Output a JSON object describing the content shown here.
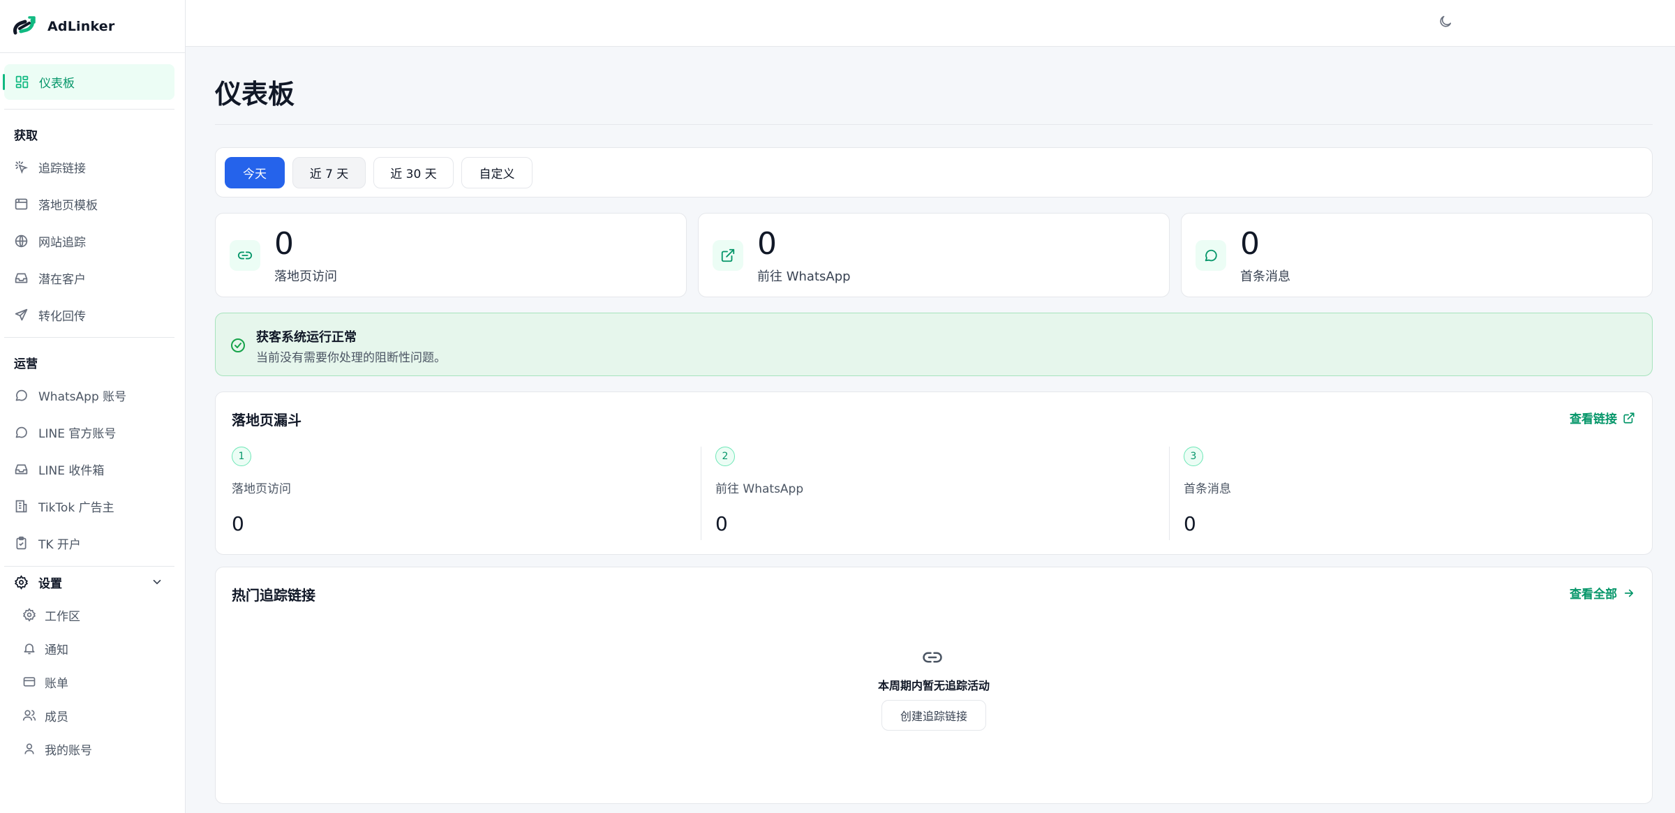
{
  "brand": {
    "name": "AdLinker"
  },
  "sidebar": {
    "active": {
      "label": "仪表板",
      "icon": "dashboard-icon"
    },
    "sections": [
      {
        "title": "获取",
        "items": [
          {
            "label": "追踪链接",
            "icon": "tracking-link-icon"
          },
          {
            "label": "落地页模板",
            "icon": "template-icon"
          },
          {
            "label": "网站追踪",
            "icon": "globe-icon"
          },
          {
            "label": "潜在客户",
            "icon": "inbox-icon"
          },
          {
            "label": "转化回传",
            "icon": "send-icon"
          }
        ]
      },
      {
        "title": "运营",
        "items": [
          {
            "label": "WhatsApp 账号",
            "icon": "chat-icon"
          },
          {
            "label": "LINE 官方账号",
            "icon": "chat-icon"
          },
          {
            "label": "LINE 收件箱",
            "icon": "inbox-icon"
          },
          {
            "label": "TikTok 广告主",
            "icon": "building-icon"
          },
          {
            "label": "TK 开户",
            "icon": "clipboard-icon"
          }
        ]
      }
    ],
    "settings": {
      "label": "设置",
      "items": [
        {
          "label": "工作区",
          "icon": "gear-icon"
        },
        {
          "label": "通知",
          "icon": "bell-icon"
        },
        {
          "label": "账单",
          "icon": "credit-card-icon"
        },
        {
          "label": "成员",
          "icon": "users-icon"
        },
        {
          "label": "我的账号",
          "icon": "user-icon"
        }
      ]
    }
  },
  "topbar": {
    "theme_icon": "moon-icon"
  },
  "page": {
    "title": "仪表板"
  },
  "ranges": {
    "options": [
      "今天",
      "近 7 天",
      "近 30 天",
      "自定义"
    ],
    "selected": "今天"
  },
  "stats": [
    {
      "value": "0",
      "label": "落地页访问",
      "icon": "link-icon"
    },
    {
      "value": "0",
      "label": "前往 WhatsApp",
      "icon": "external-link-icon"
    },
    {
      "value": "0",
      "label": "首条消息",
      "icon": "message-icon"
    }
  ],
  "health": {
    "title": "获客系统运行正常",
    "desc": "当前没有需要你处理的阻断性问题。",
    "icon": "check-circle-icon",
    "color": "#16a34a"
  },
  "funnel": {
    "title": "落地页漏斗",
    "link": "查看链接",
    "steps": [
      {
        "num": "1",
        "label": "落地页访问",
        "value": "0"
      },
      {
        "num": "2",
        "label": "前往 WhatsApp",
        "value": "0"
      },
      {
        "num": "3",
        "label": "首条消息",
        "value": "0"
      }
    ]
  },
  "hot_links": {
    "title": "热门追踪链接",
    "link": "查看全部",
    "empty_text": "本周期内暂无追踪活动",
    "create_button": "创建追踪链接"
  },
  "colors": {
    "accent": "#10b981",
    "primary": "#2563eb",
    "link": "#059669"
  }
}
